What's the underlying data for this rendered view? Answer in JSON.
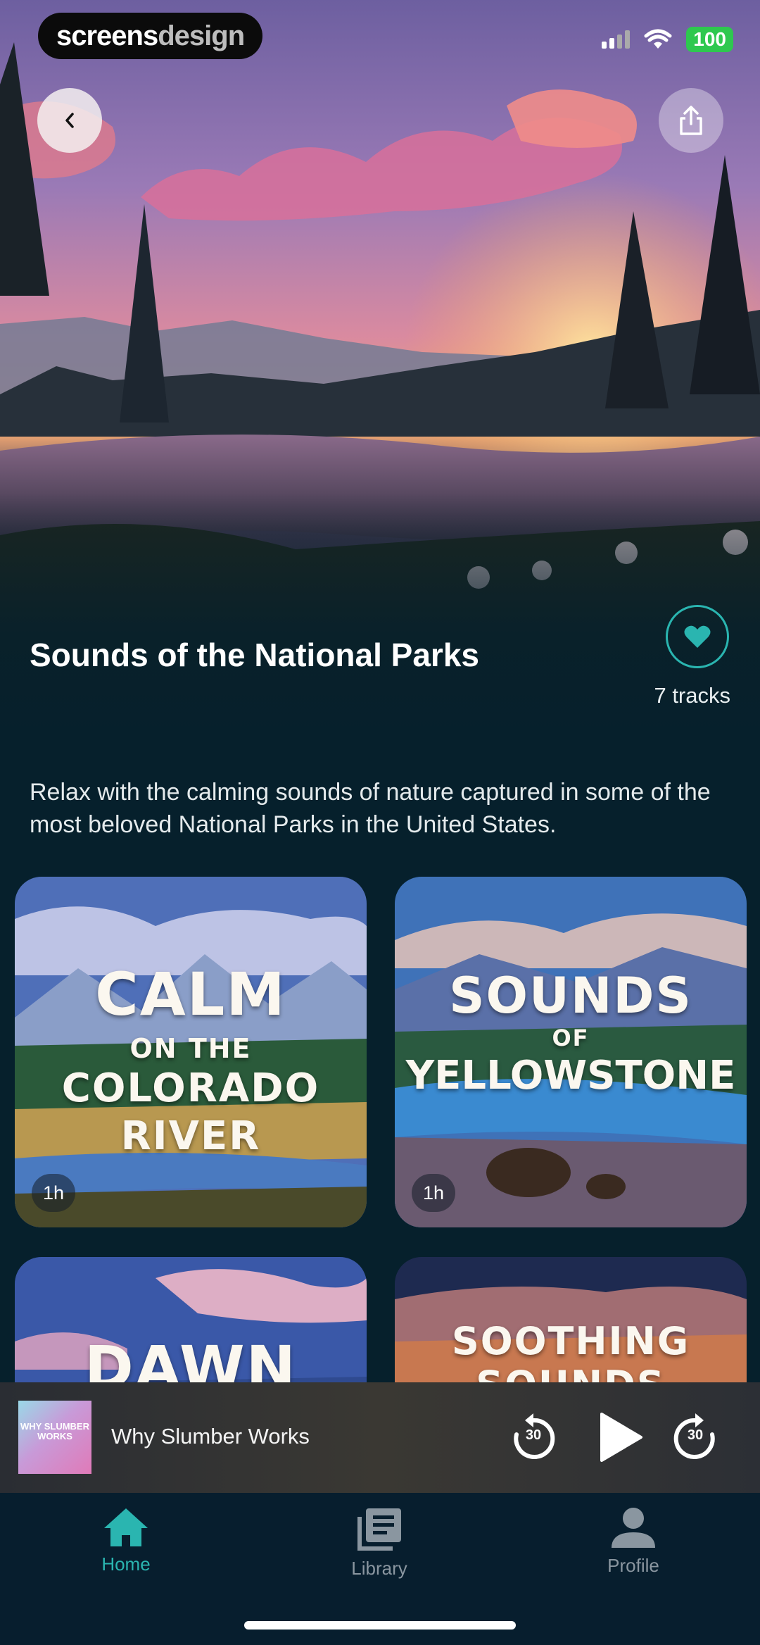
{
  "status_bar": {
    "brand_part1": "screens",
    "brand_part2": "design",
    "battery": "100"
  },
  "header": {
    "title": "Sounds of the National Parks",
    "track_count": "7 tracks",
    "description": "Relax with the calming sounds of nature captured in some of the most beloved National Parks in the United States."
  },
  "cards": [
    {
      "line1": "CALM",
      "line2": "ON THE",
      "line3": "COLORADO",
      "line4": "RIVER",
      "duration": "1h"
    },
    {
      "line1": "SOUNDS",
      "line2": "OF",
      "line3": "YELLOWSTONE",
      "line4": "",
      "duration": "1h"
    },
    {
      "line1": "DAWN",
      "line2": "",
      "line3": "",
      "line4": "",
      "duration": ""
    },
    {
      "line1": "SOOTHING",
      "line2": "SOUNDS",
      "line3": "",
      "line4": "",
      "duration": ""
    }
  ],
  "player": {
    "art_text": "WHY SLUMBER WORKS",
    "track_name": "Why Slumber Works",
    "rewind_label": "30",
    "forward_label": "30"
  },
  "nav": [
    {
      "label": "Home",
      "active": true
    },
    {
      "label": "Library",
      "active": false
    },
    {
      "label": "Profile",
      "active": false
    }
  ],
  "colors": {
    "accent": "#2ab5b0",
    "background": "#06202c",
    "nav_inactive": "#8a96a0"
  }
}
